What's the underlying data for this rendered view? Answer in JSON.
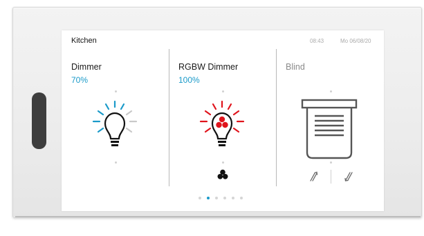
{
  "header": {
    "room": "Kitchen",
    "time": "08:43",
    "date": "Mo 06/08/20"
  },
  "cards": [
    {
      "title": "Dimmer",
      "value": "70%",
      "icon": "lightbulb-icon",
      "accent": "#1a9ac9"
    },
    {
      "title": "RGBW Dimmer",
      "value": "100%",
      "icon": "rgb-lightbulb-icon",
      "accent": "#e0141c",
      "extra_icon": "color-picker-icon"
    },
    {
      "title": "Blind",
      "icon": "blind-icon",
      "controls": [
        "blind-up-icon",
        "blind-down-icon"
      ]
    }
  ],
  "pager": {
    "count": 6,
    "active": 1
  },
  "colors": {
    "accent": "#1a9ac9",
    "rgb": "#e0141c",
    "muted": "#8a8a8a"
  }
}
